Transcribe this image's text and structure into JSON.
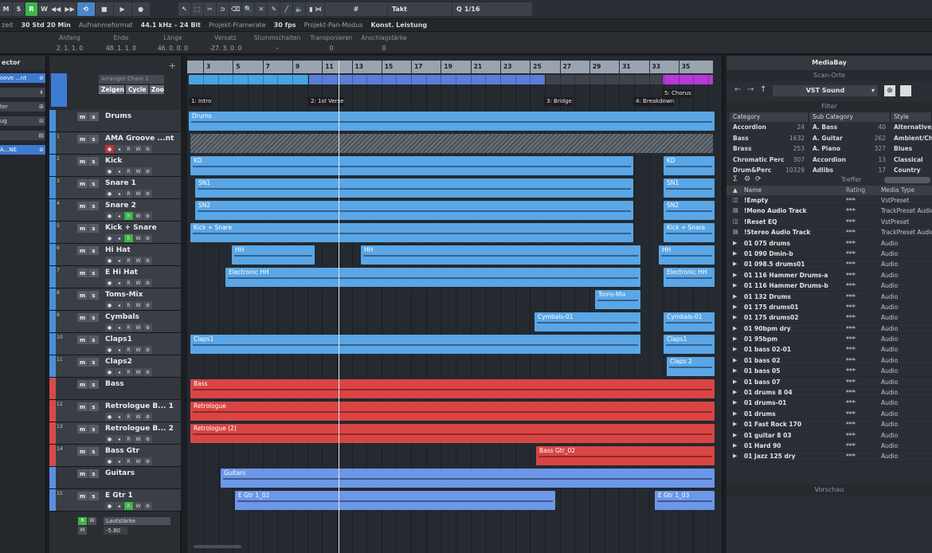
{
  "toolbar": {
    "msrw": [
      "M",
      "S",
      "R",
      "W"
    ],
    "snap_label": "Takt",
    "quantize_label": "1/16",
    "glyphs": {
      "rewind": "◀◀",
      "ffwd": "▶▶",
      "cycle": "⟲",
      "stop": "■",
      "play": "▶",
      "record": "●",
      "pointer": "↖",
      "range": "⬚",
      "scissors": "✂",
      "glue": "⊃",
      "eraser": "⌫",
      "zoom": "🔍",
      "mute": "✕",
      "draw": "✎",
      "line": "╱",
      "speaker": "🔈",
      "color": "◧",
      "snap_icon": "⋈",
      "grid": "#"
    }
  },
  "status": {
    "items": [
      {
        "label": "zeit",
        "value": "30 Std 20 Min"
      },
      {
        "label": "Aufnahmeformat",
        "value": "44.1 kHz – 24 Bit"
      },
      {
        "label": "Projekt-Framerate",
        "value": "30 fps"
      },
      {
        "label": "Projekt-Pan-Modus",
        "value": "Konst. Leistung"
      }
    ]
  },
  "infoline": {
    "cols": [
      {
        "h": "Anfang",
        "v": "2. 1. 1. 0"
      },
      {
        "h": "Ende",
        "v": "48. 1. 1. 0"
      },
      {
        "h": "Länge",
        "v": "46. 0. 0. 0"
      },
      {
        "h": "Versatz",
        "v": "-27. 3. 0. 0"
      },
      {
        "h": "Stummschalten",
        "v": "–"
      },
      {
        "h": "Transponieren",
        "v": "0"
      },
      {
        "h": "Anschlagstärke",
        "v": "0"
      }
    ]
  },
  "inspector": {
    "title": "ector",
    "rows": [
      "oove ...nt",
      "",
      "ter",
      "ug",
      "",
      "A...NE"
    ]
  },
  "tracklist": {
    "arranger_chain": "Arranger Chain 1",
    "buttons": {
      "zeigen": "Zeigen",
      "cycle": "Cycle",
      "zoom": "Zoo"
    },
    "tracks": [
      {
        "num": "",
        "name": "Drums",
        "type": "folder",
        "color": "#4a90d9"
      },
      {
        "num": "1",
        "name": "AMA Groove ...nt",
        "type": "midi",
        "color": "#4a90d9"
      },
      {
        "num": "2",
        "name": "Kick",
        "type": "audio",
        "color": "#4a90d9"
      },
      {
        "num": "3",
        "name": "Snare 1",
        "type": "audio",
        "color": "#4a90d9"
      },
      {
        "num": "4",
        "name": "Snare 2",
        "type": "audio",
        "color": "#4a90d9"
      },
      {
        "num": "5",
        "name": "Kick + Snare",
        "type": "audio",
        "color": "#4a90d9"
      },
      {
        "num": "6",
        "name": "Hi Hat",
        "type": "audio",
        "color": "#4a90d9"
      },
      {
        "num": "7",
        "name": "E Hi Hat",
        "type": "audio",
        "color": "#4a90d9"
      },
      {
        "num": "8",
        "name": "Toms-Mix",
        "type": "audio",
        "color": "#4a90d9"
      },
      {
        "num": "9",
        "name": "Cymbals",
        "type": "audio",
        "color": "#4a90d9"
      },
      {
        "num": "10",
        "name": "Claps1",
        "type": "audio",
        "color": "#4a90d9"
      },
      {
        "num": "11",
        "name": "Claps2",
        "type": "audio",
        "color": "#4a90d9"
      },
      {
        "num": "",
        "name": "Bass",
        "type": "folder",
        "color": "#d84a4a"
      },
      {
        "num": "12",
        "name": "Retrologue B... 1",
        "type": "inst",
        "color": "#d84a4a"
      },
      {
        "num": "13",
        "name": "Retrologue B... 2",
        "type": "inst",
        "color": "#d84a4a"
      },
      {
        "num": "14",
        "name": "Bass Gtr",
        "type": "audio",
        "color": "#d84a4a"
      },
      {
        "num": "",
        "name": "Guitars",
        "type": "folder",
        "color": "#5b8ee0"
      },
      {
        "num": "15",
        "name": "E Gtr 1",
        "type": "audio",
        "color": "#5b8ee0"
      }
    ],
    "lautstaerke_label": "Lautstärke",
    "lautstaerke_value": "-5.80"
  },
  "ruler": {
    "bars": [
      "3",
      "5",
      "7",
      "9",
      "11",
      "13",
      "15",
      "17",
      "19",
      "21",
      "23",
      "25",
      "27",
      "29",
      "31",
      "33",
      "35"
    ]
  },
  "markers": [
    "1: Intro",
    "2: 1st Verse",
    "3: Bridge",
    "4: Breakdown",
    "5: Chorus"
  ],
  "events": [
    {
      "label": "Drums",
      "track": 0,
      "from": 0,
      "to": 660,
      "color": "#5aa6e6"
    },
    {
      "label": "KD",
      "track": 2,
      "from": 2,
      "to": 558,
      "color": "#5aa6e6"
    },
    {
      "label": "KD",
      "track": 2,
      "from": 596,
      "to": 660,
      "color": "#5aa6e6"
    },
    {
      "label": "SN1",
      "track": 3,
      "from": 8,
      "to": 558,
      "color": "#5aa6e6"
    },
    {
      "label": "SN1",
      "track": 3,
      "from": 596,
      "to": 660,
      "color": "#5aa6e6"
    },
    {
      "label": "SN2",
      "track": 4,
      "from": 8,
      "to": 558,
      "color": "#5aa6e6"
    },
    {
      "label": "SN2",
      "track": 4,
      "from": 596,
      "to": 660,
      "color": "#5aa6e6"
    },
    {
      "label": "Kick + Snare",
      "track": 5,
      "from": 2,
      "to": 558,
      "color": "#5aa6e6"
    },
    {
      "label": "Kick + Snare",
      "track": 5,
      "from": 596,
      "to": 660,
      "color": "#5aa6e6"
    },
    {
      "label": "HH",
      "track": 6,
      "from": 54,
      "to": 158,
      "color": "#5aa6e6"
    },
    {
      "label": "HH",
      "track": 6,
      "from": 216,
      "to": 567,
      "color": "#5aa6e6"
    },
    {
      "label": "HH",
      "track": 6,
      "from": 590,
      "to": 660,
      "color": "#5aa6e6"
    },
    {
      "label": "Electronic HH",
      "track": 7,
      "from": 46,
      "to": 567,
      "color": "#5aa6e6"
    },
    {
      "label": "Electronic HH",
      "track": 7,
      "from": 596,
      "to": 660,
      "color": "#5aa6e6"
    },
    {
      "label": "Toms-Mix",
      "track": 8,
      "from": 510,
      "to": 567,
      "color": "#5aa6e6"
    },
    {
      "label": "Cymbals-01",
      "track": 9,
      "from": 434,
      "to": 567,
      "color": "#5aa6e6"
    },
    {
      "label": "Cymbals-01",
      "track": 9,
      "from": 596,
      "to": 660,
      "color": "#5aa6e6"
    },
    {
      "label": "Claps1",
      "track": 10,
      "from": 2,
      "to": 567,
      "color": "#5aa6e6"
    },
    {
      "label": "Claps1",
      "track": 10,
      "from": 596,
      "to": 660,
      "color": "#5aa6e6"
    },
    {
      "label": "Claps 2",
      "track": 11,
      "from": 600,
      "to": 660,
      "color": "#5aa6e6"
    },
    {
      "label": "Bass",
      "track": 12,
      "from": 2,
      "to": 660,
      "color": "#d94545"
    },
    {
      "label": "Retrologue",
      "track": 13,
      "from": 2,
      "to": 660,
      "color": "#d94545"
    },
    {
      "label": "Retrologue (2)",
      "track": 14,
      "from": 2,
      "to": 660,
      "color": "#d94545"
    },
    {
      "label": "Bass Gtr_02",
      "track": 15,
      "from": 436,
      "to": 660,
      "color": "#d94545"
    },
    {
      "label": "Guitars",
      "track": 16,
      "from": 40,
      "to": 660,
      "color": "#6d97e8"
    },
    {
      "label": "E Gtr 1_02",
      "track": 17,
      "from": 58,
      "to": 460,
      "color": "#6d97e8"
    },
    {
      "label": "E Gtr 1_03",
      "track": 17,
      "from": 585,
      "to": 660,
      "color": "#6d97e8"
    }
  ],
  "mediabay": {
    "title": "MediaBay",
    "scan_title": "Scan-Orte",
    "location": "VST Sound",
    "filter_title": "Filter",
    "treffer": "Treffer",
    "vorschau": "Vorschau",
    "nav_glyphs": {
      "back": "←",
      "forward": "→",
      "up": "↑",
      "dropdown": "▾",
      "clear": "⊗"
    },
    "category": {
      "header": "Category",
      "rows": [
        [
          "Accordion",
          "24"
        ],
        [
          "Bass",
          "1632"
        ],
        [
          "Brass",
          "253"
        ],
        [
          "Chromatic Perc",
          "307"
        ],
        [
          "Drum&Perc",
          "10329"
        ]
      ]
    },
    "subcategory": {
      "header": "Sub Category",
      "rows": [
        [
          "A. Bass",
          "40"
        ],
        [
          "A. Guitar",
          "262"
        ],
        [
          "A. Piano",
          "327"
        ],
        [
          "Accordion",
          "13"
        ],
        [
          "Adlibs",
          "17"
        ]
      ]
    },
    "style": {
      "header": "Style",
      "rows": [
        "Alternative/I",
        "Ambient/Ch",
        "Blues",
        "Classical",
        "Country"
      ]
    },
    "results_head": {
      "name": "Name",
      "rating": "Rating",
      "mtype": "Media Type"
    },
    "results": [
      {
        "icon": "◫",
        "name": "!Empty",
        "rating": "***",
        "mtype": "VstPreset"
      },
      {
        "icon": "▤",
        "name": "!Mono Audio Track",
        "rating": "***",
        "mtype": "TrackPreset Audio"
      },
      {
        "icon": "◫",
        "name": "!Reset EQ",
        "rating": "***",
        "mtype": "VstPreset"
      },
      {
        "icon": "▤",
        "name": "!Stereo Audio Track",
        "rating": "***",
        "mtype": "TrackPreset Audio"
      },
      {
        "icon": "▶",
        "name": "01 075 drums",
        "rating": "***",
        "mtype": "Audio"
      },
      {
        "icon": "▶",
        "name": "01 090 Dmin-b",
        "rating": "***",
        "mtype": "Audio"
      },
      {
        "icon": "▶",
        "name": "01 098.5 drums01",
        "rating": "***",
        "mtype": "Audio"
      },
      {
        "icon": "▶",
        "name": "01 116 Hammer Drums-a",
        "rating": "***",
        "mtype": "Audio"
      },
      {
        "icon": "▶",
        "name": "01 116 Hammer Drums-b",
        "rating": "***",
        "mtype": "Audio"
      },
      {
        "icon": "▶",
        "name": "01 132 Drums",
        "rating": "***",
        "mtype": "Audio"
      },
      {
        "icon": "▶",
        "name": "01 175 drums01",
        "rating": "***",
        "mtype": "Audio"
      },
      {
        "icon": "▶",
        "name": "01 175 drums02",
        "rating": "***",
        "mtype": "Audio"
      },
      {
        "icon": "▶",
        "name": "01 90bpm dry",
        "rating": "***",
        "mtype": "Audio"
      },
      {
        "icon": "▶",
        "name": "01 95bpm",
        "rating": "***",
        "mtype": "Audio"
      },
      {
        "icon": "▶",
        "name": "01 bass 02-01",
        "rating": "***",
        "mtype": "Audio"
      },
      {
        "icon": "▶",
        "name": "01 bass 02",
        "rating": "***",
        "mtype": "Audio"
      },
      {
        "icon": "▶",
        "name": "01 bass 05",
        "rating": "***",
        "mtype": "Audio"
      },
      {
        "icon": "▶",
        "name": "01 bass 07",
        "rating": "***",
        "mtype": "Audio"
      },
      {
        "icon": "▶",
        "name": "01 drums 8 04",
        "rating": "***",
        "mtype": "Audio"
      },
      {
        "icon": "▶",
        "name": "01 drums-01",
        "rating": "***",
        "mtype": "Audio"
      },
      {
        "icon": "▶",
        "name": "01 drums",
        "rating": "***",
        "mtype": "Audio"
      },
      {
        "icon": "▶",
        "name": "01 Fast Rock 170",
        "rating": "***",
        "mtype": "Audio"
      },
      {
        "icon": "▶",
        "name": "01 guitar 8 03",
        "rating": "***",
        "mtype": "Audio"
      },
      {
        "icon": "▶",
        "name": "01 Hard 90",
        "rating": "***",
        "mtype": "Audio"
      },
      {
        "icon": "▶",
        "name": "01 Jazz 125 dry",
        "rating": "***",
        "mtype": "Audio"
      }
    ]
  }
}
